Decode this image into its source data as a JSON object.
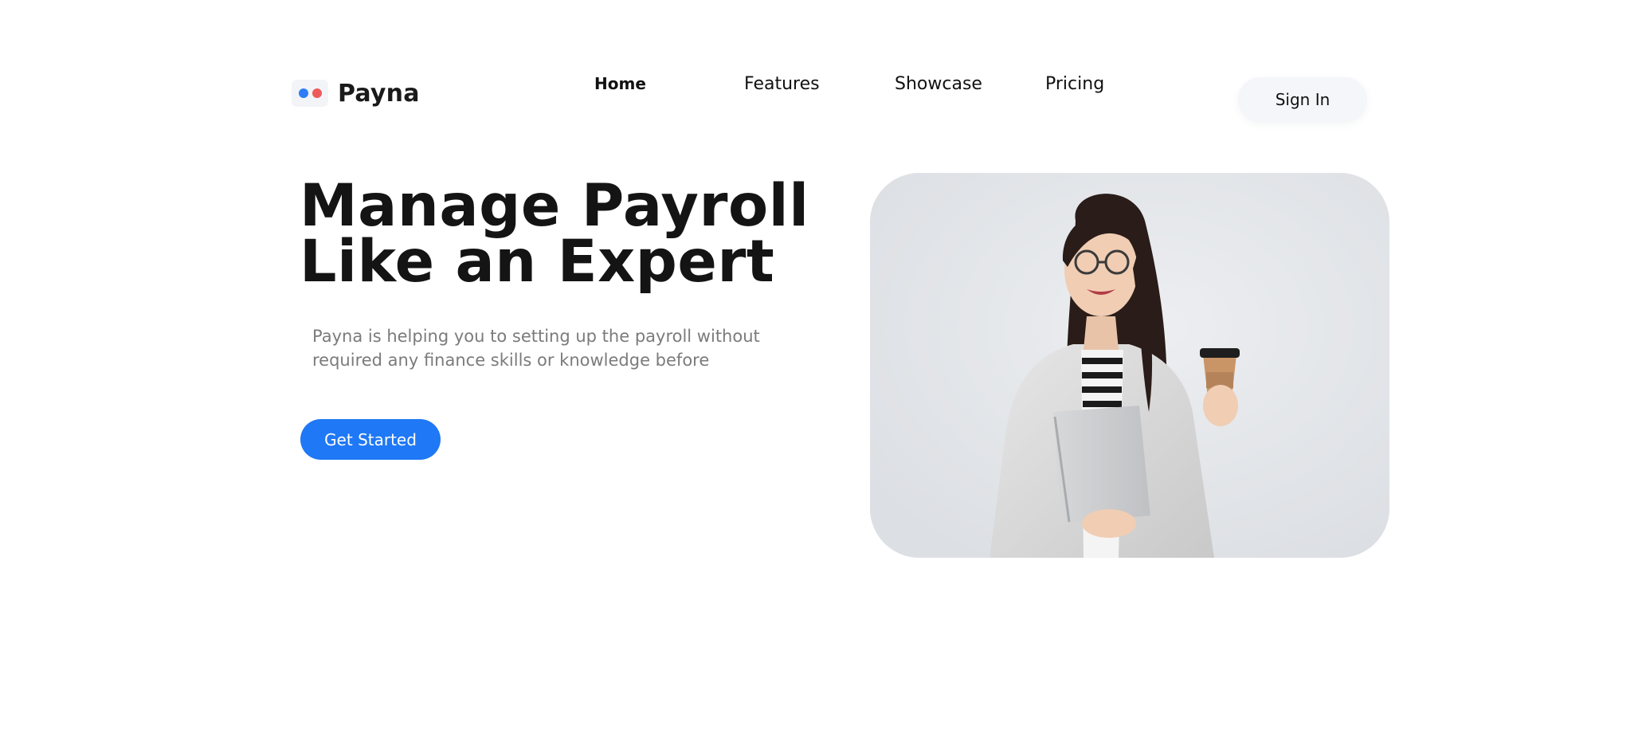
{
  "brand": {
    "name": "Payna",
    "logo_dot_colors": [
      "#2f7cf6",
      "#ee5a5a"
    ]
  },
  "nav": {
    "items": [
      {
        "label": "Home",
        "active": true
      },
      {
        "label": "Features",
        "active": false
      },
      {
        "label": "Showcase",
        "active": false
      },
      {
        "label": "Pricing",
        "active": false
      }
    ],
    "signin_label": "Sign In"
  },
  "hero": {
    "title_line1": "Manage Payroll",
    "title_line2": "Like an Expert",
    "description_line1": "Payna is helping you to setting up the payroll without",
    "description_line2": "required any finance skills or knowledge before",
    "cta_label": "Get Started",
    "image_subject": "businesswoman-with-coffee-and-laptop"
  },
  "colors": {
    "accent": "#1f78f5",
    "title_text": "#141414",
    "muted_text": "#7b7b7b",
    "signin_bg": "#f5f6fa"
  }
}
